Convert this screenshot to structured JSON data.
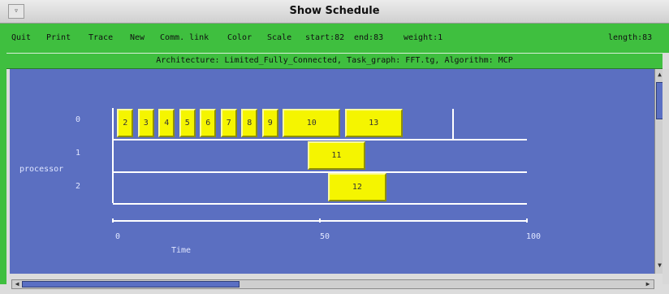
{
  "window": {
    "title": "Show Schedule",
    "menu_icon": "window-menu-icon"
  },
  "menu": {
    "quit": "Quit",
    "print": "Print",
    "trace": "Trace",
    "new": "New",
    "comm_link": "Comm. link",
    "color": "Color",
    "scale": "Scale",
    "start": "start:82",
    "end": "end:83",
    "weight": "weight:1",
    "length": "length:83"
  },
  "info": "Architecture: Limited_Fully_Connected, Task_graph: FFT.tg, Algorithm: MCP",
  "chart": {
    "y_label": "processor",
    "x_label": "Time",
    "processors": [
      "0",
      "1",
      "2"
    ],
    "ticks": [
      "0",
      "50",
      "100"
    ]
  },
  "chart_data": {
    "type": "gantt",
    "title": "",
    "xlabel": "Time",
    "ylabel": "processor",
    "xlim": [
      0,
      100
    ],
    "tasks": [
      {
        "label": "2",
        "processor": 0,
        "start": 1,
        "end": 5
      },
      {
        "label": "3",
        "processor": 0,
        "start": 6,
        "end": 10
      },
      {
        "label": "4",
        "processor": 0,
        "start": 11,
        "end": 15
      },
      {
        "label": "5",
        "processor": 0,
        "start": 16,
        "end": 20
      },
      {
        "label": "6",
        "processor": 0,
        "start": 21,
        "end": 25
      },
      {
        "label": "7",
        "processor": 0,
        "start": 26,
        "end": 30
      },
      {
        "label": "8",
        "processor": 0,
        "start": 31,
        "end": 35
      },
      {
        "label": "9",
        "processor": 0,
        "start": 36,
        "end": 40
      },
      {
        "label": "10",
        "processor": 0,
        "start": 41,
        "end": 55
      },
      {
        "label": "13",
        "processor": 0,
        "start": 56,
        "end": 70
      },
      {
        "label": "11",
        "processor": 1,
        "start": 47,
        "end": 61
      },
      {
        "label": "12",
        "processor": 2,
        "start": 52,
        "end": 66
      }
    ],
    "marker_time": 82
  },
  "colors": {
    "menu_bg": "#3fbf3f",
    "canvas_bg": "#5b6fc1",
    "task_fill": "#f5f500"
  }
}
